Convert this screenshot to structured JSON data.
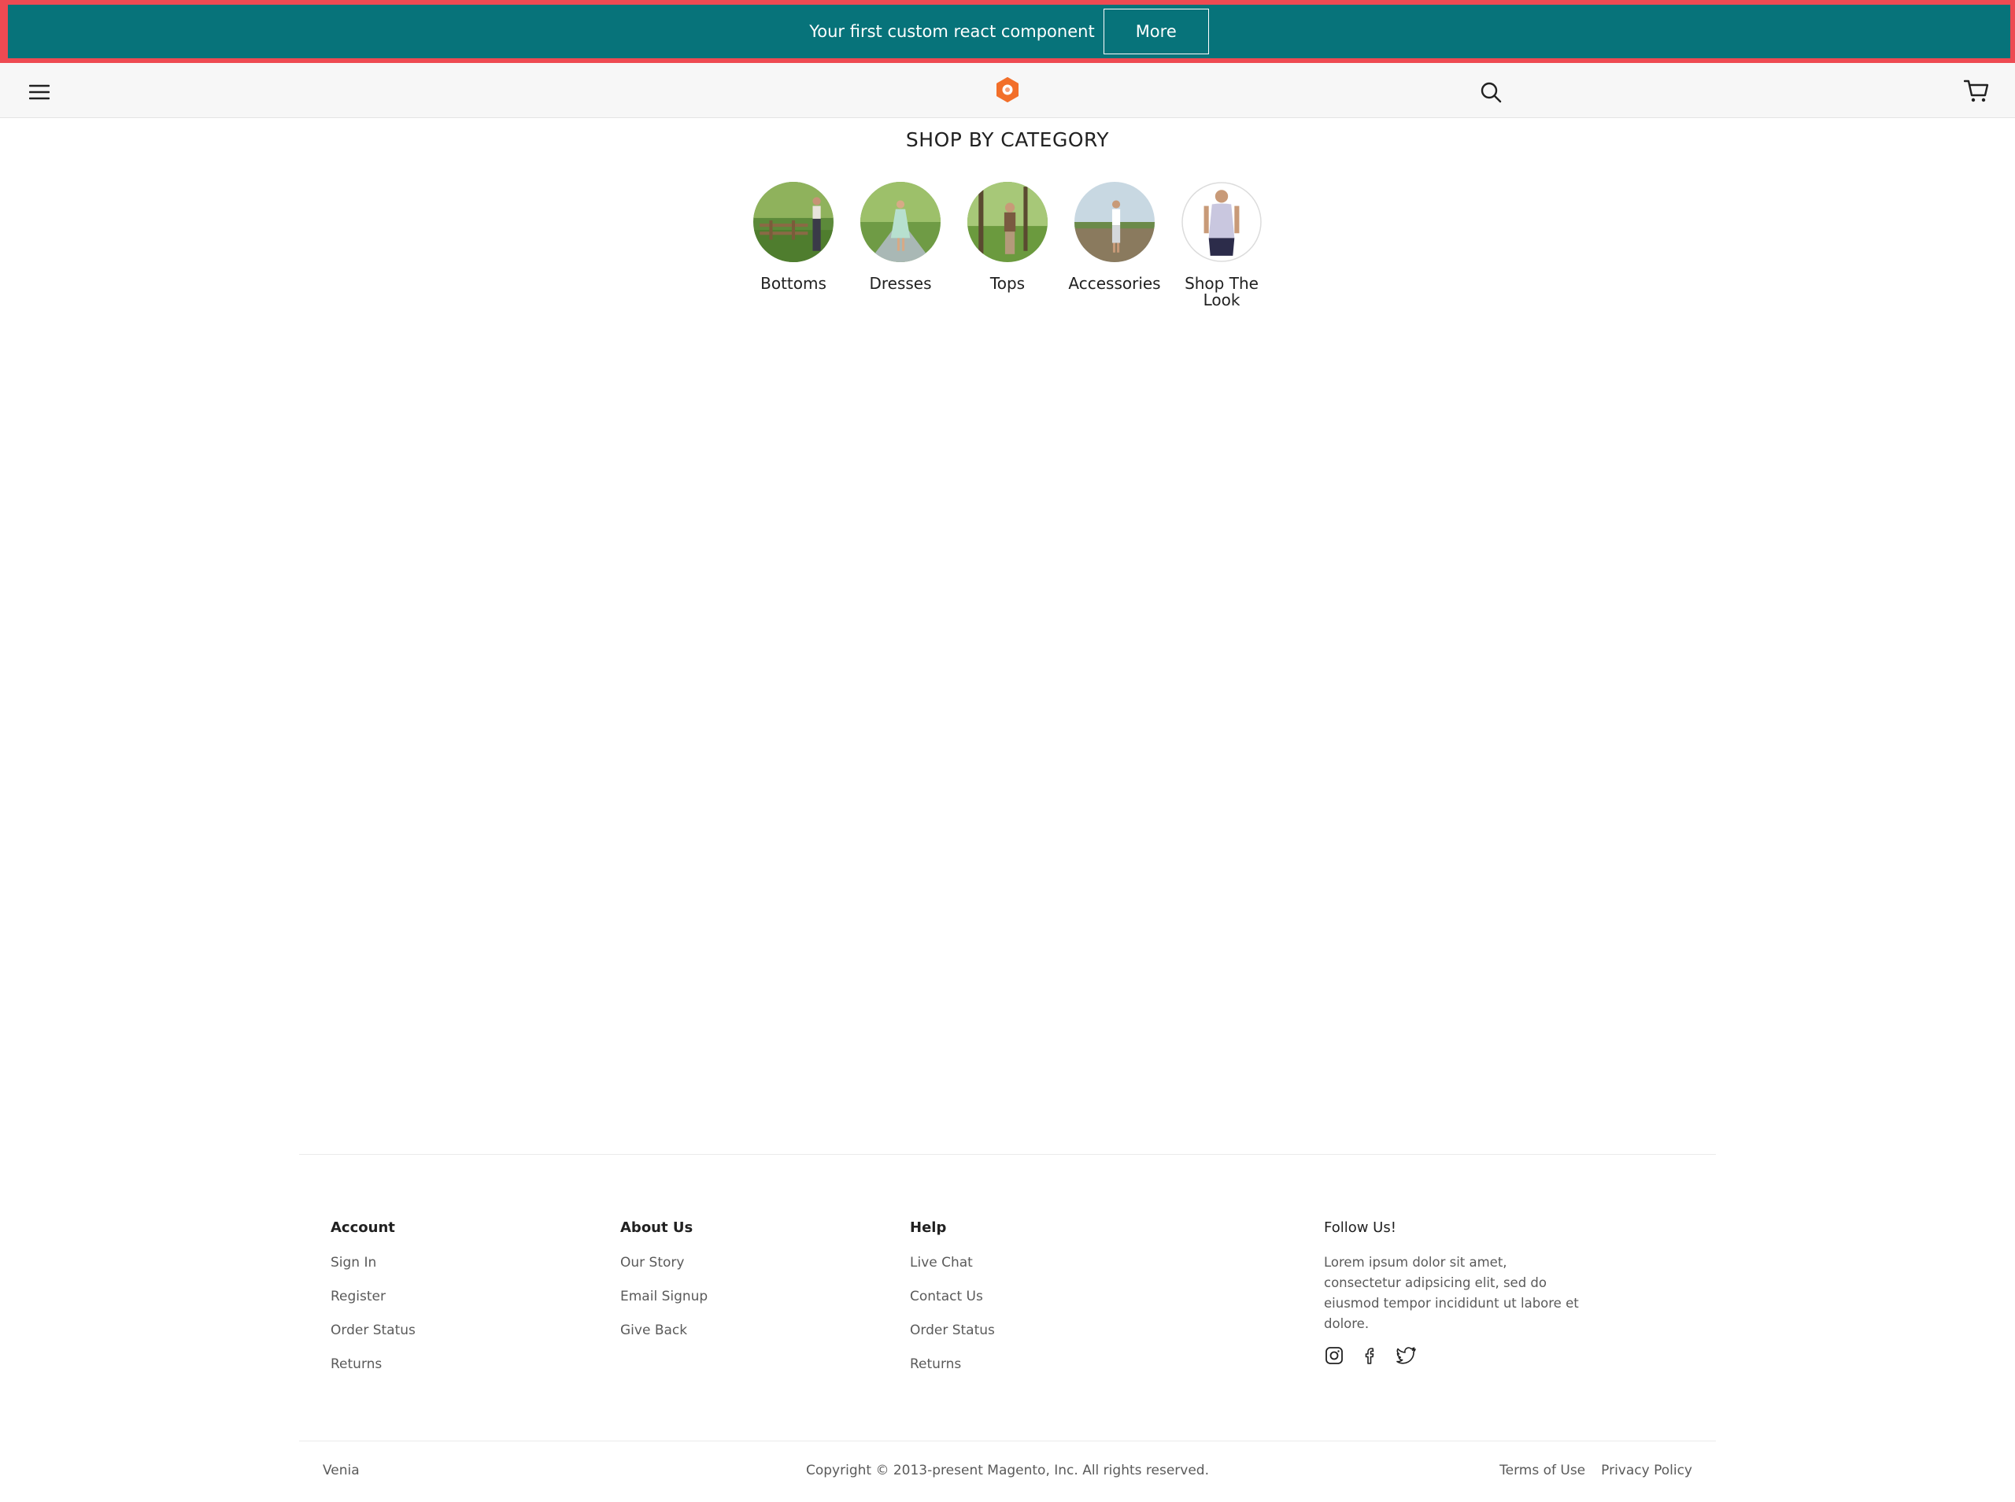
{
  "banner": {
    "text": "Your first custom react component",
    "button_label": "More",
    "background": "#07737a",
    "outline_color": "#ee4a52"
  },
  "header": {
    "menu_icon": "hamburger-menu-icon",
    "logo_icon": "venia-logo-icon",
    "search_icon": "search-icon",
    "cart_icon": "shopping-cart-icon",
    "logo_color": "#f26f2a"
  },
  "category": {
    "title": "SHOP BY CATEGORY",
    "items": [
      {
        "label": "Bottoms"
      },
      {
        "label": "Dresses"
      },
      {
        "label": "Tops"
      },
      {
        "label": "Accessories"
      },
      {
        "label": "Shop The Look"
      }
    ]
  },
  "footer": {
    "account": {
      "heading": "Account",
      "links": [
        "Sign In",
        "Register",
        "Order Status",
        "Returns"
      ]
    },
    "about": {
      "heading": "About Us",
      "links": [
        "Our Story",
        "Email Signup",
        "Give Back"
      ]
    },
    "help": {
      "heading": "Help",
      "links": [
        "Live Chat",
        "Contact Us",
        "Order Status",
        "Returns"
      ]
    },
    "follow": {
      "heading": "Follow Us!",
      "text": "Lorem ipsum dolor sit amet, consectetur adipsicing elit, sed do eiusmod tempor incididunt ut labore et dolore.",
      "icons": [
        "instagram-icon",
        "facebook-icon",
        "twitter-icon"
      ]
    },
    "brand": "Venia",
    "copyright": "Copyright © 2013-present Magento, Inc. All rights reserved.",
    "terms": "Terms of Use",
    "privacy": "Privacy Policy"
  }
}
